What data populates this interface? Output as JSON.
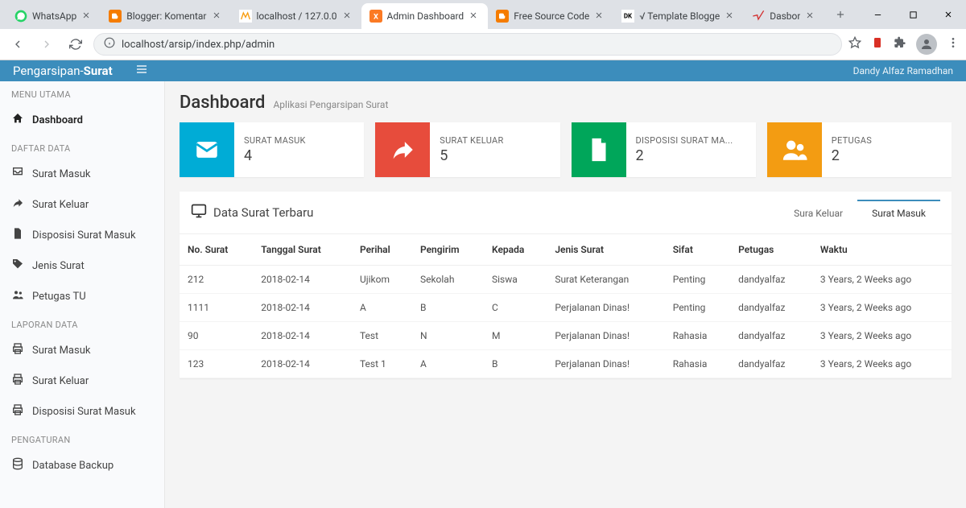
{
  "browser": {
    "tabs": [
      {
        "title": "WhatsApp",
        "favicon": "whatsapp",
        "active": false
      },
      {
        "title": "Blogger: Komentar",
        "favicon": "blogger",
        "active": false
      },
      {
        "title": "localhost / 127.0.0",
        "favicon": "pma",
        "active": false
      },
      {
        "title": "Admin Dashboard",
        "favicon": "xampp",
        "active": true
      },
      {
        "title": "Free Source Code",
        "favicon": "blogger",
        "active": false
      },
      {
        "title": "√ Template Blogge",
        "favicon": "dk",
        "active": false
      },
      {
        "title": "Dasbor",
        "favicon": "dash",
        "active": false
      }
    ],
    "url": "localhost/arsip/index.php/admin"
  },
  "header": {
    "app_name_1": "Pengarsipan-",
    "app_name_2": "Surat",
    "user_name": "Dandy Alfaz Ramadhan"
  },
  "sidebar": {
    "sections": [
      {
        "heading": "MENU UTAMA",
        "items": [
          {
            "label": "Dashboard",
            "icon": "home",
            "active": true
          }
        ]
      },
      {
        "heading": "DAFTAR DATA",
        "items": [
          {
            "label": "Surat Masuk",
            "icon": "inbox"
          },
          {
            "label": "Surat Keluar",
            "icon": "share"
          },
          {
            "label": "Disposisi Surat Masuk",
            "icon": "file"
          },
          {
            "label": "Jenis Surat",
            "icon": "tag"
          },
          {
            "label": "Petugas TU",
            "icon": "users"
          }
        ]
      },
      {
        "heading": "LAPORAN DATA",
        "items": [
          {
            "label": "Surat Masuk",
            "icon": "print"
          },
          {
            "label": "Surat Keluar",
            "icon": "print"
          },
          {
            "label": "Disposisi Surat Masuk",
            "icon": "print"
          }
        ]
      },
      {
        "heading": "PENGATURAN",
        "items": [
          {
            "label": "Database Backup",
            "icon": "db"
          }
        ]
      }
    ]
  },
  "page": {
    "title": "Dashboard",
    "subtitle": "Aplikasi Pengarsipan Surat"
  },
  "stats": [
    {
      "label": "SURAT MASUK",
      "value": "4",
      "color": "c-blue",
      "icon": "mail"
    },
    {
      "label": "SURAT KELUAR",
      "value": "5",
      "color": "c-orange",
      "icon": "send"
    },
    {
      "label": "DISPOSISI SURAT MA...",
      "value": "2",
      "color": "c-green",
      "icon": "doc"
    },
    {
      "label": "PETUGAS",
      "value": "2",
      "color": "c-yellow",
      "icon": "people"
    }
  ],
  "panel": {
    "title": "Data Surat Terbaru",
    "tabs": [
      {
        "label": "Sura Keluar",
        "active": false
      },
      {
        "label": "Surat Masuk",
        "active": true
      }
    ]
  },
  "table": {
    "columns": [
      "No. Surat",
      "Tanggal Surat",
      "Perihal",
      "Pengirim",
      "Kepada",
      "Jenis Surat",
      "Sifat",
      "Petugas",
      "Waktu"
    ],
    "rows": [
      [
        "212",
        "2018-02-14",
        "Ujikom",
        "Sekolah",
        "Siswa",
        "Surat Keterangan",
        "Penting",
        "dandyalfaz",
        "3 Years, 2 Weeks ago"
      ],
      [
        "1111",
        "2018-02-14",
        "A",
        "B",
        "C",
        "Perjalanan Dinas!",
        "Penting",
        "dandyalfaz",
        "3 Years, 2 Weeks ago"
      ],
      [
        "90",
        "2018-02-14",
        "Test",
        "N",
        "M",
        "Perjalanan Dinas!",
        "Rahasia",
        "dandyalfaz",
        "3 Years, 2 Weeks ago"
      ],
      [
        "123",
        "2018-02-14",
        "Test 1",
        "A",
        "B",
        "Perjalanan Dinas!",
        "Rahasia",
        "dandyalfaz",
        "3 Years, 2 Weeks ago"
      ]
    ]
  }
}
